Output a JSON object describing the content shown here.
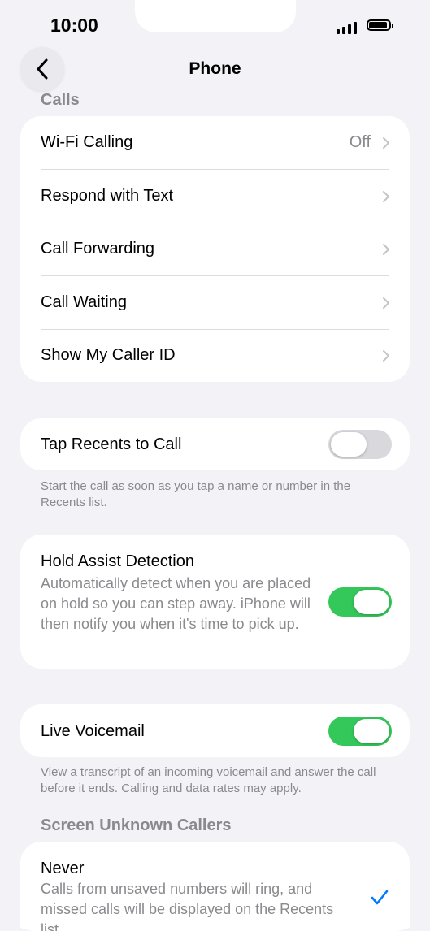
{
  "status": {
    "time": "10:00"
  },
  "nav": {
    "title": "Phone"
  },
  "calls_section": {
    "header": "Calls",
    "rows": [
      {
        "label": "Wi-Fi Calling",
        "value": "Off"
      },
      {
        "label": "Respond with Text"
      },
      {
        "label": "Call Forwarding"
      },
      {
        "label": "Call Waiting"
      },
      {
        "label": "Show My Caller ID"
      }
    ]
  },
  "tap_recents": {
    "label": "Tap Recents to Call",
    "enabled": false,
    "footnote": "Start the call as soon as you tap a name or number in the Recents list."
  },
  "hold_assist": {
    "label": "Hold Assist Detection",
    "description": "Automatically detect when you are placed on hold so you can step away. iPhone will then notify you when it's time to pick up.",
    "enabled": true
  },
  "live_voicemail": {
    "label": "Live Voicemail",
    "enabled": true,
    "footnote": "View a transcript of an incoming voicemail and answer the call before it ends. Calling and data rates may apply."
  },
  "screen_unknown": {
    "header": "Screen Unknown Callers",
    "option_label": "Never",
    "option_description": "Calls from unsaved numbers will ring, and missed calls will be displayed on the Recents list.",
    "selected": true
  },
  "colors": {
    "accent": "#007aff",
    "toggle_on": "#34c759",
    "secondary_text": "#8a8a8e"
  }
}
